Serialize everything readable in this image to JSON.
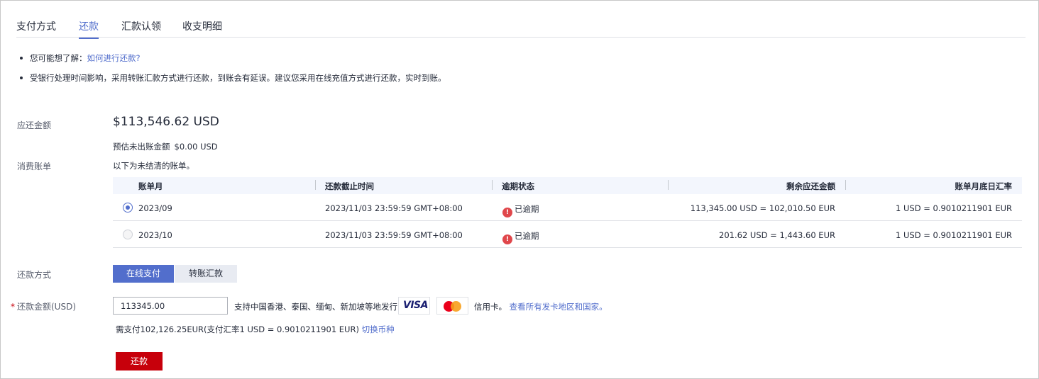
{
  "tabs": [
    {
      "label": "支付方式"
    },
    {
      "label": "还款"
    },
    {
      "label": "汇款认领"
    },
    {
      "label": "收支明细"
    }
  ],
  "active_tab": "还款",
  "tips": {
    "tip1_prefix": "您可能想了解：",
    "tip1_link": "如何进行还款?",
    "tip2": "受银行处理时间影响，采用转账汇款方式进行还款，到账会有延误。建议您采用在线充值方式进行还款，实时到账。"
  },
  "due": {
    "label": "应还金额",
    "amount": "$113,546.62 USD",
    "estimated_label": "预估未出账金额",
    "estimated_value": "$0.00 USD"
  },
  "bills": {
    "label": "消费账单",
    "intro": "以下为未结清的账单。",
    "columns": [
      "账单月",
      "还款截止时间",
      "逾期状态",
      "剩余应还金额",
      "账单月底日汇率"
    ],
    "rows": [
      {
        "selected": true,
        "month": "2023/09",
        "deadline": "2023/11/03 23:59:59 GMT+08:00",
        "status": "已逾期",
        "remaining": "113,345.00 USD = 102,010.50 EUR",
        "rate": "1 USD = 0.9010211901 EUR"
      },
      {
        "selected": false,
        "month": "2023/10",
        "deadline": "2023/11/03 23:59:59 GMT+08:00",
        "status": "已逾期",
        "remaining": "201.62 USD = 1,443.60 EUR",
        "rate": "1 USD = 0.9010211901 EUR"
      }
    ]
  },
  "payment_method": {
    "label": "还款方式",
    "options": [
      "在线支付",
      "转账汇款"
    ],
    "selected": "在线支付"
  },
  "repay_amount": {
    "required_mark": "*",
    "label": "还款金额(USD)",
    "value": "113345.00",
    "support_text": "支持中国香港、泰国、缅甸、新加坡等地发行的",
    "visa_logo_text": "VISA",
    "credit_suffix": "信用卡。",
    "credit_link": "查看所有发卡地区和国家。",
    "need_text": "需支付102,126.25EUR(支付汇率1 USD = 0.9010211901 EUR)",
    "switch_link": "切换币种"
  },
  "submit_label": "还款",
  "colors": {
    "accent": "#526ecc",
    "danger": "#c7000b",
    "overdue": "#e0474b"
  }
}
